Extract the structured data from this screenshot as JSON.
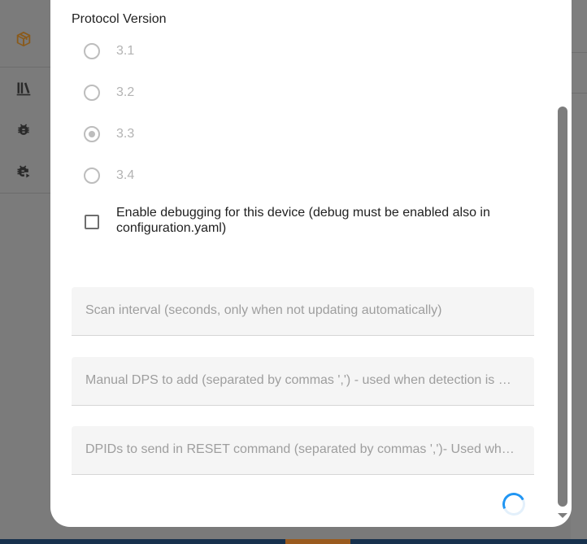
{
  "sidebar": {
    "icons": [
      "package-icon",
      "library-icon",
      "bug-icon",
      "bug-play-icon"
    ],
    "accent_color": "#e8a12b"
  },
  "dialog": {
    "protocol_version": {
      "label": "Protocol Version",
      "options": [
        "3.1",
        "3.2",
        "3.3",
        "3.4"
      ],
      "selected": "3.3"
    },
    "debug_checkbox": {
      "label": "Enable debugging for this device (debug must be enabled also in configuration.yaml)",
      "checked": false
    },
    "fields": {
      "scan_interval": "Scan interval (seconds, only when not updating automatically)",
      "manual_dps": "Manual DPS to add (separated by commas ',') - used when detection is not working",
      "reset_dpids": "DPIDs to send in RESET command (separated by commas ',')- Used when device does not respond"
    }
  },
  "spinner_color": "#2196f3"
}
